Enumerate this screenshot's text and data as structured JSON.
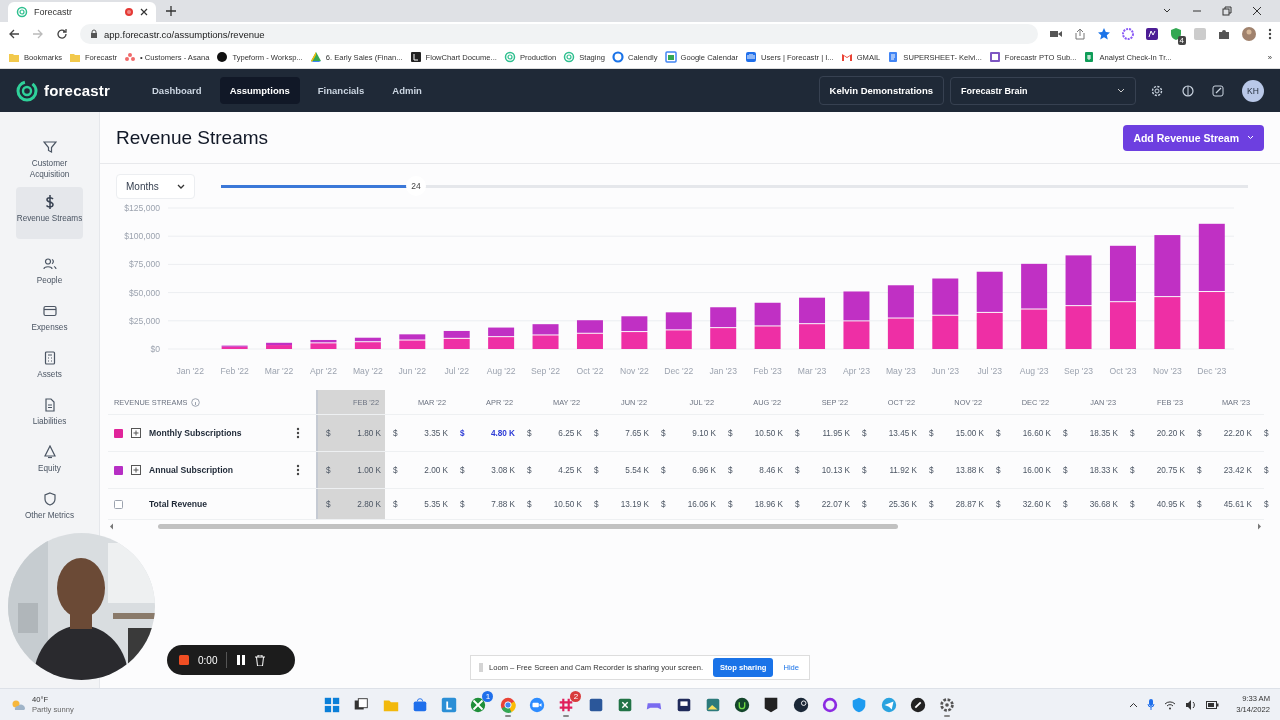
{
  "browser": {
    "tab": {
      "title": "Forecastr"
    },
    "url": "app.forecastr.co/assumptions/revenue",
    "extension_badge": "4",
    "bookmarks": [
      {
        "label": "Bookmarks",
        "kind": "folder"
      },
      {
        "label": "Forecastr",
        "kind": "folder"
      },
      {
        "label": "• Customers - Asana",
        "kind": "asana"
      },
      {
        "label": "Typeform - Worksp...",
        "kind": "typeform"
      },
      {
        "label": "6. Early Sales (Finan...",
        "kind": "drive"
      },
      {
        "label": "FlowChart Docume...",
        "kind": "flowchart"
      },
      {
        "label": "Production",
        "kind": "forecastr"
      },
      {
        "label": "Staging",
        "kind": "forecastr"
      },
      {
        "label": "Calendly",
        "kind": "calendly"
      },
      {
        "label": "Google Calendar",
        "kind": "calendar"
      },
      {
        "label": "Users | Forecastr | I...",
        "kind": "intercom"
      },
      {
        "label": "GMAIL",
        "kind": "gmail"
      },
      {
        "label": "SUPERSHEET- Kelvi...",
        "kind": "docs"
      },
      {
        "label": "Forecastr PTO Sub...",
        "kind": "forms"
      },
      {
        "label": "Analyst Check-In Tr...",
        "kind": "sheets"
      }
    ],
    "bookmarks_more": "»"
  },
  "app_header": {
    "logo": "forecastr",
    "nav": [
      {
        "label": "Dashboard",
        "selected": false
      },
      {
        "label": "Assumptions",
        "selected": true
      },
      {
        "label": "Financials",
        "selected": false
      },
      {
        "label": "Admin",
        "selected": false
      }
    ],
    "workspace": "Kelvin Demonstrations",
    "model": "Forecastr Brain",
    "avatar": "KH"
  },
  "sidebar": {
    "items": [
      {
        "label": "Customer Acquisition",
        "kind": "funnel",
        "selected": false
      },
      {
        "label": "Revenue Streams",
        "kind": "dollar",
        "selected": true
      },
      {
        "label": "People",
        "kind": "people",
        "selected": false
      },
      {
        "label": "Expenses",
        "kind": "card",
        "selected": false
      },
      {
        "label": "Assets",
        "kind": "calculator",
        "selected": false
      },
      {
        "label": "Liabilities",
        "kind": "document",
        "selected": false
      },
      {
        "label": "Equity",
        "kind": "bell",
        "selected": false
      },
      {
        "label": "Other Metrics",
        "kind": "shield",
        "selected": false
      }
    ]
  },
  "page": {
    "title": "Revenue Streams",
    "add_button": "Add Revenue Stream"
  },
  "controls": {
    "period": "Months",
    "range_slider": {
      "level": 0.19,
      "reading": "24"
    }
  },
  "chart": {
    "chart_data": {
      "type": "bar",
      "stacked": true,
      "grid": true,
      "categories": [
        "Jan '22",
        "Feb '22",
        "Mar '22",
        "Apr '22",
        "May '22",
        "Jun '22",
        "Jul '22",
        "Aug '22",
        "Sep '22",
        "Oct '22",
        "Nov '22",
        "Dec '22",
        "Jan '23",
        "Feb '23",
        "Mar '23",
        "Apr '23",
        "May '23",
        "Jun '23",
        "Jul '23",
        "Aug '23",
        "Sep '23",
        "Oct '23",
        "Nov '23",
        "Dec '23"
      ],
      "series": [
        {
          "color": "#ee2fa5",
          "values": [
            0,
            2000,
            3500,
            5000,
            6000,
            7500,
            9000,
            10500,
            12000,
            13500,
            15000,
            16500,
            18500,
            20000,
            22000,
            24500,
            27000,
            29500,
            32000,
            35000,
            38000,
            41500,
            46000,
            50500
          ]
        },
        {
          "color": "#c030c4",
          "values": [
            0,
            1000,
            2000,
            3000,
            4000,
            5500,
            7000,
            8500,
            10000,
            12000,
            14000,
            16000,
            18500,
            21000,
            23500,
            26500,
            29500,
            33000,
            36500,
            40500,
            45000,
            50000,
            55000,
            60500
          ]
        }
      ],
      "ylim": [
        0,
        125000
      ],
      "yticks": [
        {
          "value": 0,
          "label": "$0"
        },
        {
          "value": 25000,
          "label": "$25,000"
        },
        {
          "value": 50000,
          "label": "$50,000"
        },
        {
          "value": 75000,
          "label": "$75,000"
        },
        {
          "value": 100000,
          "label": "$100,000"
        },
        {
          "value": 125000,
          "label": "$125,000"
        }
      ]
    }
  },
  "table": {
    "heading": "REVENUE STREAMS",
    "columns": [
      {
        "label": "FEB '22",
        "highlighted": true
      },
      {
        "label": "MAR '22",
        "highlighted": false
      },
      {
        "label": "APR '22",
        "highlighted": false
      },
      {
        "label": "MAY '22",
        "highlighted": false
      },
      {
        "label": "JUN '22",
        "highlighted": false
      },
      {
        "label": "JUL '22",
        "highlighted": false
      },
      {
        "label": "AUG '22",
        "highlighted": false
      },
      {
        "label": "SEP '22",
        "highlighted": false
      },
      {
        "label": "OCT '22",
        "highlighted": false
      },
      {
        "label": "NOV '22",
        "highlighted": false
      },
      {
        "label": "DEC '22",
        "highlighted": false
      },
      {
        "label": "JAN '23",
        "highlighted": false
      },
      {
        "label": "FEB '23",
        "highlighted": false
      },
      {
        "label": "MAR '23",
        "highlighted": false
      }
    ],
    "rows": [
      {
        "name": "Monthly Subscriptions",
        "kind": "stream",
        "color": "#e0249a",
        "cells": [
          {
            "currency": "$",
            "value": "1.80 K",
            "selected": false
          },
          {
            "currency": "$",
            "value": "3.35 K",
            "selected": false
          },
          {
            "currency": "$",
            "value": "4.80 K",
            "selected": true
          },
          {
            "currency": "$",
            "value": "6.25 K",
            "selected": false
          },
          {
            "currency": "$",
            "value": "7.65 K",
            "selected": false
          },
          {
            "currency": "$",
            "value": "9.10 K",
            "selected": false
          },
          {
            "currency": "$",
            "value": "10.50 K",
            "selected": false
          },
          {
            "currency": "$",
            "value": "11.95 K",
            "selected": false
          },
          {
            "currency": "$",
            "value": "13.45 K",
            "selected": false
          },
          {
            "currency": "$",
            "value": "15.00 K",
            "selected": false
          },
          {
            "currency": "$",
            "value": "16.60 K",
            "selected": false
          },
          {
            "currency": "$",
            "value": "18.35 K",
            "selected": false
          },
          {
            "currency": "$",
            "value": "20.20 K",
            "selected": false
          },
          {
            "currency": "$",
            "value": "22.20 K",
            "selected": false
          },
          {
            "currency": "$",
            "selected": false
          }
        ]
      },
      {
        "name": "Annual Subscription",
        "kind": "stream",
        "color": "#b62ec4",
        "cells": [
          {
            "currency": "$",
            "value": "1.00 K",
            "selected": false
          },
          {
            "currency": "$",
            "value": "2.00 K",
            "selected": false
          },
          {
            "currency": "$",
            "value": "3.08 K",
            "selected": false
          },
          {
            "currency": "$",
            "value": "4.25 K",
            "selected": false
          },
          {
            "currency": "$",
            "value": "5.54 K",
            "selected": false
          },
          {
            "currency": "$",
            "value": "6.96 K",
            "selected": false
          },
          {
            "currency": "$",
            "value": "8.46 K",
            "selected": false
          },
          {
            "currency": "$",
            "value": "10.13 K",
            "selected": false
          },
          {
            "currency": "$",
            "value": "11.92 K",
            "selected": false
          },
          {
            "currency": "$",
            "value": "13.88 K",
            "selected": false
          },
          {
            "currency": "$",
            "value": "16.00 K",
            "selected": false
          },
          {
            "currency": "$",
            "value": "18.33 K",
            "selected": false
          },
          {
            "currency": "$",
            "value": "20.75 K",
            "selected": false
          },
          {
            "currency": "$",
            "value": "23.42 K",
            "selected": false
          },
          {
            "currency": "$",
            "selected": false
          }
        ]
      },
      {
        "name": "Total Revenue",
        "kind": "total",
        "cells": [
          {
            "currency": "$",
            "value": "2.80 K",
            "selected": false
          },
          {
            "currency": "$",
            "value": "5.35 K",
            "selected": false
          },
          {
            "currency": "$",
            "value": "7.88 K",
            "selected": false
          },
          {
            "currency": "$",
            "value": "10.50 K",
            "selected": false
          },
          {
            "currency": "$",
            "value": "13.19 K",
            "selected": false
          },
          {
            "currency": "$",
            "value": "16.06 K",
            "selected": false
          },
          {
            "currency": "$",
            "value": "18.96 K",
            "selected": false
          },
          {
            "currency": "$",
            "value": "22.07 K",
            "selected": false
          },
          {
            "currency": "$",
            "value": "25.36 K",
            "selected": false
          },
          {
            "currency": "$",
            "value": "28.87 K",
            "selected": false
          },
          {
            "currency": "$",
            "value": "32.60 K",
            "selected": false
          },
          {
            "currency": "$",
            "value": "36.68 K",
            "selected": false
          },
          {
            "currency": "$",
            "value": "40.95 K",
            "selected": false
          },
          {
            "currency": "$",
            "value": "45.61 K",
            "selected": false
          },
          {
            "currency": "$",
            "selected": false
          }
        ]
      }
    ]
  },
  "recorder": {
    "timer": "0:00",
    "notice": "Loom – Free Screen and Cam Recorder is sharing your screen.",
    "stop_button": "Stop sharing",
    "hide_link": "Hide"
  },
  "taskbar": {
    "weather": {
      "temperature": "40°F",
      "condition": "Partly sunny"
    },
    "apps": [
      {
        "kind": "start",
        "running": false
      },
      {
        "kind": "taskview",
        "running": false
      },
      {
        "kind": "folder",
        "running": false
      },
      {
        "kind": "store",
        "running": false
      },
      {
        "kind": "blue",
        "running": false
      },
      {
        "kind": "xbox",
        "running": false,
        "badge": "1"
      },
      {
        "kind": "chrome",
        "running": true
      },
      {
        "kind": "zoom",
        "running": false
      },
      {
        "kind": "slack",
        "running": true,
        "badge": "2"
      },
      {
        "kind": "word",
        "running": false
      },
      {
        "kind": "excel",
        "running": false
      },
      {
        "kind": "game",
        "running": false
      },
      {
        "kind": "monitor",
        "running": false
      },
      {
        "kind": "photos",
        "running": false
      },
      {
        "kind": "upwork",
        "running": false
      },
      {
        "kind": "epic",
        "running": false
      },
      {
        "kind": "steam",
        "running": false
      },
      {
        "kind": "ring",
        "running": false
      },
      {
        "kind": "shield",
        "running": false
      },
      {
        "kind": "telegram",
        "running": false
      },
      {
        "kind": "dark",
        "running": false
      },
      {
        "kind": "settings",
        "running": true
      }
    ],
    "time": "9:33 AM",
    "date": "3/14/2022"
  }
}
